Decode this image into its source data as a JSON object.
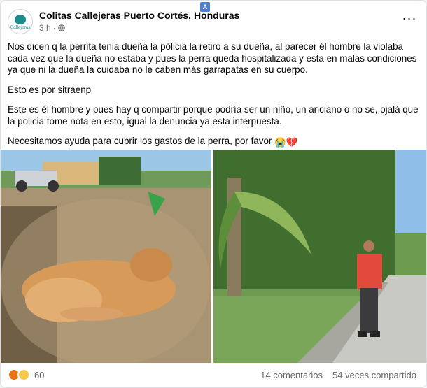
{
  "page": {
    "name": "Colitas Callejeras Puerto Cortés, Honduras",
    "avatar_text": "Callejeras",
    "time": "3 h",
    "translate_icon": "translate-icon"
  },
  "post": {
    "paragraphs": [
      "Nos dicen q la perrita tenia dueña la pólicia la retiro a su dueña, al parecer él hombre la violaba cada vez que la dueña no estaba y pues la perra queda hospitalizada y esta en malas condiciones ya que ni la dueña la cuidaba no le caben más garrapatas en su cuerpo.",
      "Esto es por sitraenp",
      "Este es él hombre y pues hay q compartir porque podría ser un niño, un anciano o no se, ojalá que la policia tome nota en esto, igual la denuncia ya esta interpuesta.",
      "Necesitamos ayuda para cubrir los gastos de la perra, por favor"
    ],
    "emojis": "😭💔"
  },
  "photos": [
    {
      "subject": "injured dog lying on dirt ground"
    },
    {
      "subject": "man in red shirt standing on sidewalk by palm trees"
    }
  ],
  "footer": {
    "reaction_count": "60",
    "comments": "14 comentarios",
    "shares": "54 veces compartido"
  },
  "colors": {
    "text": "#050505",
    "secondary": "#65676b",
    "brand_teal": "#1e8c8c"
  }
}
